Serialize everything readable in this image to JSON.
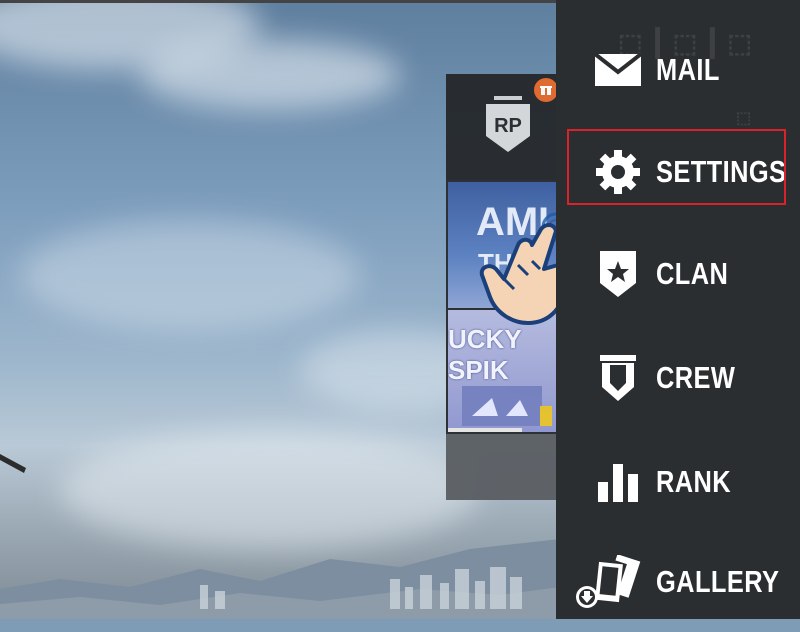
{
  "menu": {
    "items": [
      {
        "label": "MAIL",
        "icon": "mail-icon"
      },
      {
        "label": "SETTINGS",
        "icon": "gear-icon"
      },
      {
        "label": "CLAN",
        "icon": "clan-shield-icon"
      },
      {
        "label": "CREW",
        "icon": "crew-banner-icon"
      },
      {
        "label": "RANK",
        "icon": "rank-bars-icon"
      },
      {
        "label": "GALLERY",
        "icon": "gallery-cards-icon"
      }
    ],
    "highlighted": "SETTINGS",
    "highlight_color": "#d8232a"
  },
  "rp_panel": {
    "badge": "RP",
    "card_1_text": "AMU",
    "card_1_sub": "TH",
    "card_2_text": "UCKY SPIK"
  },
  "colors": {
    "menu_bg": "#2b2e31",
    "label": "#ffffff",
    "gift_badge": "#e46a2c"
  }
}
